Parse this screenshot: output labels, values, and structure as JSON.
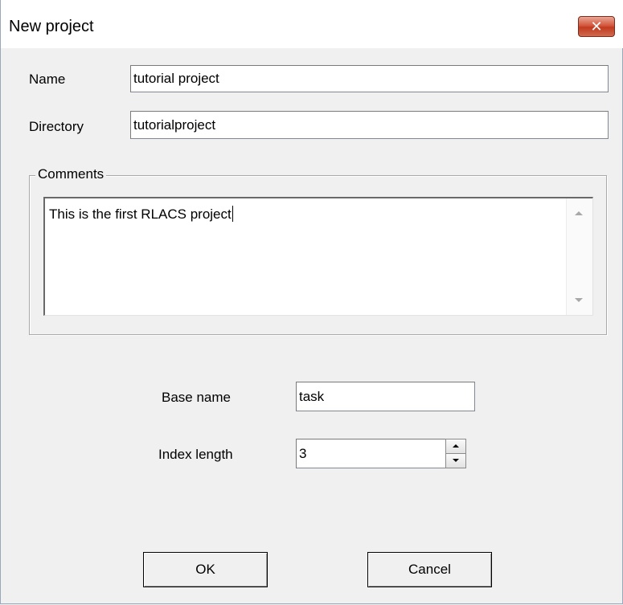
{
  "window": {
    "title": "New project",
    "close_glyph": "✕"
  },
  "form": {
    "name_label": "Name",
    "name_value": "tutorial project",
    "directory_label": "Directory",
    "directory_value": "tutorialproject",
    "comments_label": "Comments",
    "comments_value": "This is the first RLACS project",
    "base_name_label": "Base name",
    "base_name_value": "task",
    "index_length_label": "Index length",
    "index_length_value": "3"
  },
  "buttons": {
    "ok_label": "OK",
    "cancel_label": "Cancel"
  }
}
